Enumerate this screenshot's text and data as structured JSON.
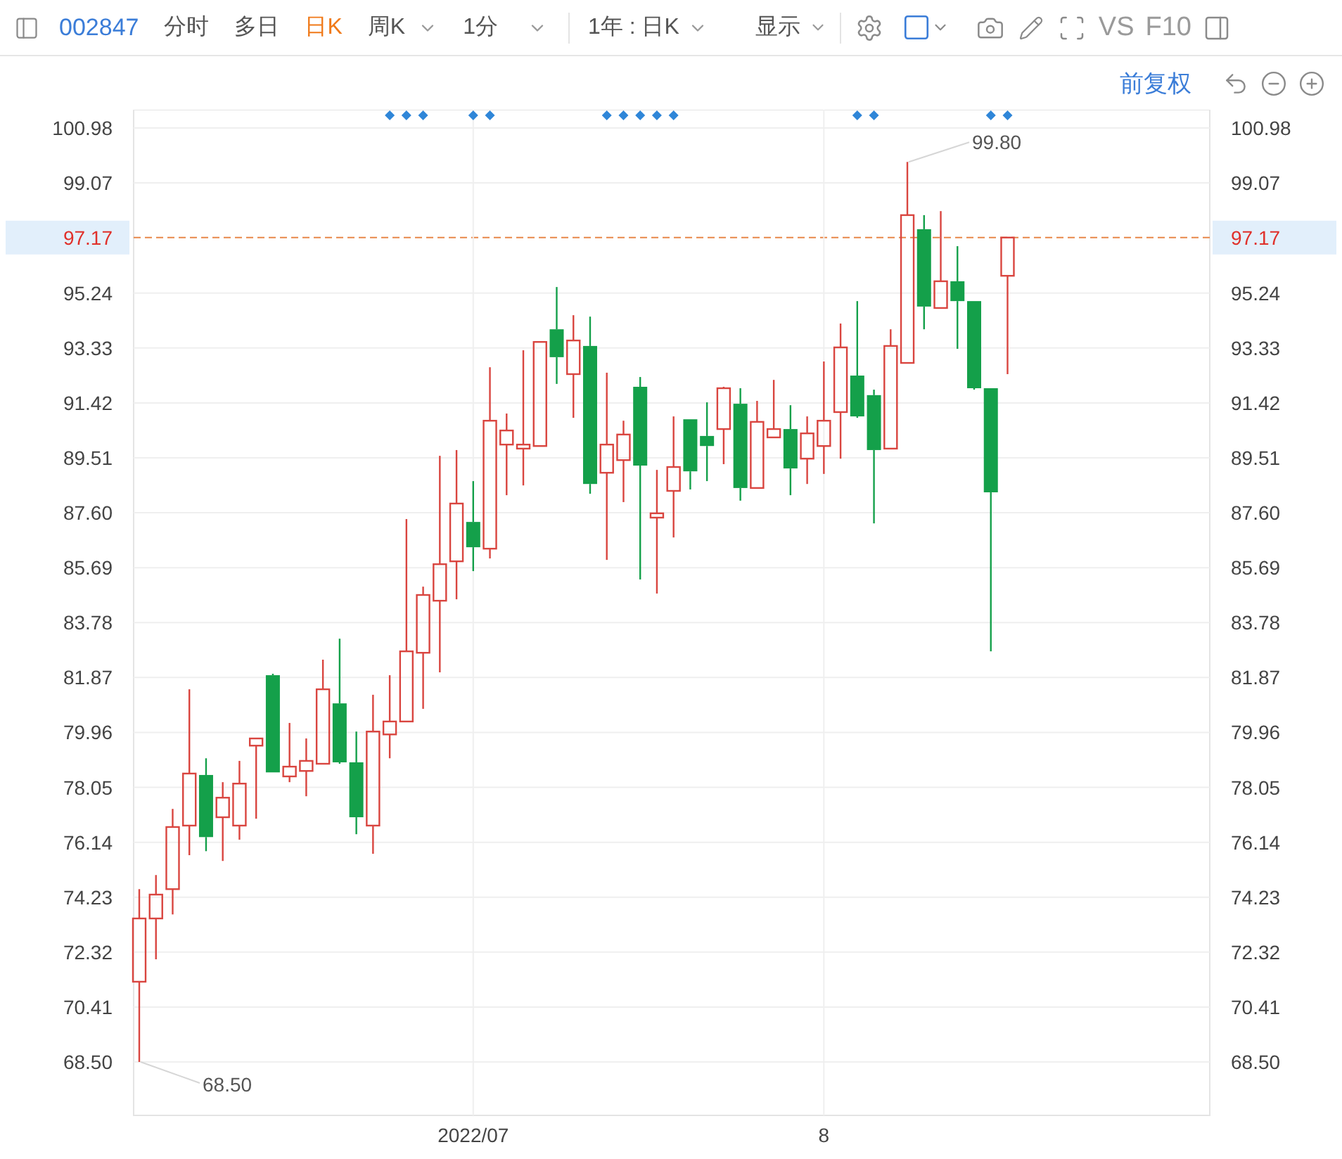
{
  "toolbar": {
    "code": "002847",
    "tabs": [
      {
        "label": "分时",
        "selected": false,
        "kind": "plain"
      },
      {
        "label": "多日",
        "selected": false,
        "kind": "plain"
      },
      {
        "label": "日K",
        "selected": true,
        "kind": "plain"
      },
      {
        "label": "周K",
        "selected": false,
        "kind": "dropdown"
      },
      {
        "label": "1分",
        "selected": false,
        "kind": "dropdown"
      }
    ],
    "range": "1年 : 日K",
    "display": "显示",
    "text_buttons": [
      "VS",
      "F10"
    ]
  },
  "chart_toolbar": {
    "adjust": "前复权"
  },
  "chart": {
    "chart_data": {
      "type": "candlestick",
      "grid": true,
      "ylim": [
        68.5,
        100.98
      ],
      "yticks": [
        100.98,
        99.07,
        97.17,
        95.24,
        93.33,
        91.42,
        89.51,
        {
          "value": 87.6,
          "label": "87.60"
        },
        85.69,
        83.78,
        81.87,
        79.96,
        78.05,
        76.14,
        74.23,
        72.32,
        70.41,
        {
          "value": 68.5,
          "label": "68.50"
        }
      ],
      "categories": [
        null,
        null,
        null,
        null,
        null,
        null,
        null,
        null,
        null,
        null,
        null,
        null,
        null,
        null,
        null,
        null,
        null,
        null,
        null,
        null,
        "2022/07",
        null,
        null,
        null,
        null,
        null,
        null,
        null,
        null,
        null,
        null,
        null,
        null,
        null,
        null,
        null,
        null,
        null,
        null,
        null,
        null,
        "8",
        null,
        null,
        null,
        null,
        null,
        null,
        null,
        null,
        null,
        null,
        null
      ],
      "ohlc": [
        [
          71.29,
          74.51,
          68.5,
          73.49
        ],
        [
          73.49,
          75.0,
          72.07,
          74.32
        ],
        [
          74.51,
          77.3,
          73.63,
          76.67
        ],
        [
          76.72,
          81.46,
          75.69,
          78.53
        ],
        [
          78.48,
          79.06,
          75.83,
          76.32
        ],
        [
          77.01,
          78.23,
          75.49,
          77.69
        ],
        [
          76.72,
          78.97,
          76.23,
          78.18
        ],
        [
          79.5,
          79.75,
          76.96,
          79.75
        ],
        [
          81.95,
          82.0,
          78.57,
          78.57
        ],
        [
          78.43,
          80.29,
          78.23,
          78.77
        ],
        [
          78.62,
          79.75,
          77.74,
          78.97
        ],
        [
          78.87,
          82.49,
          78.87,
          81.46
        ],
        [
          80.97,
          83.22,
          78.87,
          78.92
        ],
        [
          78.92,
          79.99,
          76.42,
          77.01
        ],
        [
          76.72,
          81.27,
          75.74,
          79.99
        ],
        [
          79.89,
          81.95,
          79.06,
          80.34
        ],
        [
          80.34,
          87.38,
          80.34,
          82.78
        ],
        [
          82.73,
          85.03,
          80.78,
          84.74
        ],
        [
          84.54,
          89.58,
          82.05,
          85.81
        ],
        [
          85.91,
          89.78,
          84.59,
          87.92
        ],
        [
          87.28,
          88.7,
          85.57,
          86.4
        ],
        [
          86.35,
          92.66,
          86.01,
          90.8
        ],
        [
          89.97,
          91.05,
          88.21,
          90.46
        ],
        [
          89.83,
          93.25,
          88.55,
          89.97
        ],
        [
          89.92,
          93.54,
          89.92,
          93.54
        ],
        [
          93.98,
          95.45,
          92.08,
          93.01
        ],
        [
          92.42,
          94.47,
          90.9,
          93.59
        ],
        [
          93.4,
          94.42,
          88.26,
          88.6
        ],
        [
          88.99,
          92.47,
          85.96,
          89.97
        ],
        [
          89.43,
          90.8,
          87.97,
          90.32
        ],
        [
          91.98,
          92.32,
          85.28,
          89.24
        ],
        [
          87.43,
          89.09,
          84.79,
          87.58
        ],
        [
          88.36,
          90.95,
          86.74,
          89.19
        ],
        [
          90.85,
          90.85,
          88.41,
          89.04
        ],
        [
          90.27,
          91.44,
          88.7,
          89.92
        ],
        [
          90.51,
          91.98,
          89.29,
          91.93
        ],
        [
          91.39,
          91.93,
          88.02,
          88.46
        ],
        [
          88.46,
          91.49,
          88.46,
          90.76
        ],
        [
          90.22,
          92.22,
          90.22,
          90.51
        ],
        [
          90.51,
          91.34,
          88.21,
          89.14
        ],
        [
          89.48,
          90.95,
          88.6,
          90.36
        ],
        [
          89.92,
          92.86,
          88.95,
          90.8
        ],
        [
          91.1,
          94.18,
          89.48,
          93.35
        ],
        [
          92.37,
          94.96,
          90.9,
          90.95
        ],
        [
          91.69,
          91.88,
          87.23,
          89.78
        ],
        [
          89.83,
          93.98,
          89.83,
          93.4
        ],
        [
          92.81,
          99.8,
          92.81,
          97.95
        ],
        [
          97.46,
          97.95,
          93.98,
          94.77
        ],
        [
          94.72,
          98.09,
          94.72,
          95.65
        ],
        [
          95.65,
          96.87,
          93.3,
          94.96
        ],
        [
          94.96,
          94.96,
          91.88,
          91.93
        ],
        [
          91.93,
          91.93,
          82.78,
          88.31
        ],
        [
          95.84,
          97.17,
          92.42,
          97.17
        ]
      ],
      "ref_lines": [
        {
          "axis": "y",
          "value": 97.17
        }
      ],
      "annotations": [
        {
          "text": "99.80"
        },
        {
          "text": "68.50"
        }
      ]
    },
    "event_markers": [
      false,
      false,
      false,
      false,
      false,
      false,
      false,
      false,
      false,
      false,
      false,
      false,
      false,
      false,
      false,
      true,
      true,
      true,
      false,
      false,
      true,
      true,
      false,
      false,
      false,
      false,
      false,
      false,
      true,
      true,
      true,
      true,
      true,
      false,
      false,
      false,
      false,
      false,
      false,
      false,
      false,
      false,
      false,
      true,
      true,
      false,
      false,
      false,
      false,
      false,
      false,
      true,
      true
    ],
    "right_axis": {
      "labels": [
        "100.98",
        "99.07",
        "97.17",
        "95.24",
        "93.33",
        "91.42",
        "89.51",
        "87.60",
        "85.69",
        "83.78",
        "81.87",
        "79.96",
        "78.05",
        "76.14",
        "74.23",
        "72.32",
        "70.41",
        "68.50"
      ]
    }
  }
}
